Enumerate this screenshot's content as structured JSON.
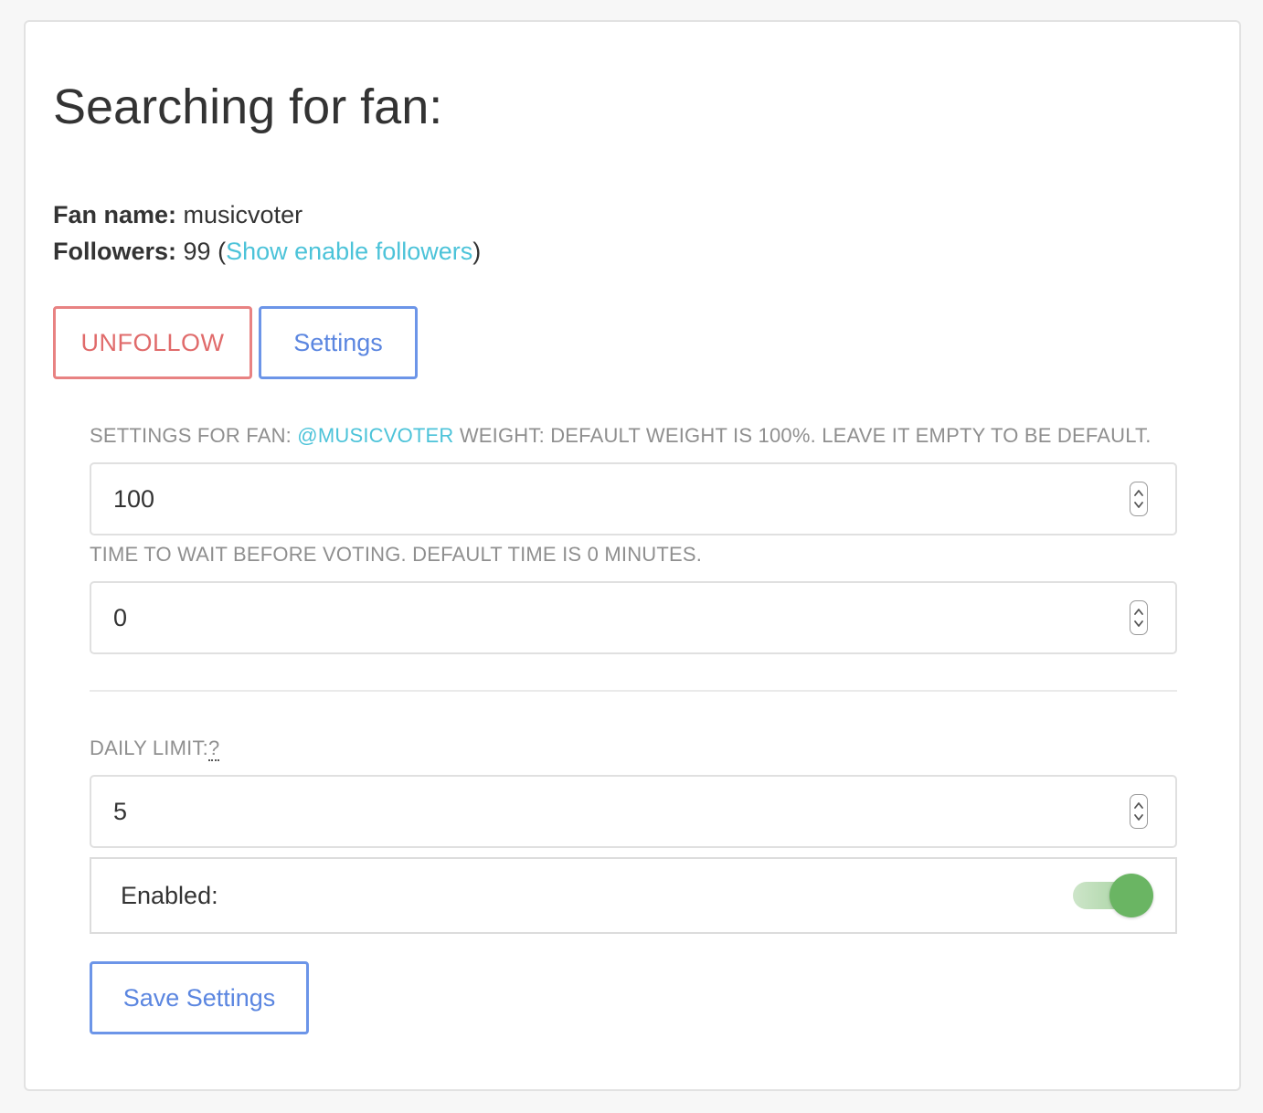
{
  "page": {
    "title": "Searching for fan:"
  },
  "fan": {
    "name_label": "Fan name:",
    "name": "musicvoter",
    "followers_label": "Followers:",
    "followers_count": "99",
    "open_paren": " (",
    "followers_link": "Show enable followers",
    "close_paren": ")"
  },
  "actions": {
    "unfollow_label": "UNFOLLOW",
    "settings_label": "Settings"
  },
  "settings": {
    "weight_label_prefix": "Settings for fan: ",
    "weight_label_handle": "@musicvoter",
    "weight_label_suffix": " Weight: Default weight is 100%. Leave it empty to be default.",
    "weight_value": "100",
    "time_label": "Time to wait before voting. Default time is 0 minutes.",
    "time_value": "0",
    "daily_label": "Daily limit:",
    "daily_help": "?",
    "daily_value": "5",
    "enabled_label": "Enabled:",
    "enabled": true,
    "save_label": "Save Settings"
  },
  "colors": {
    "unfollow": "#e06b6b",
    "primary": "#5b86e0",
    "link": "#4cc3d9",
    "toggle_on": "#6ab563"
  },
  "icons": {
    "spinner": "up-down-chevron-icon"
  }
}
